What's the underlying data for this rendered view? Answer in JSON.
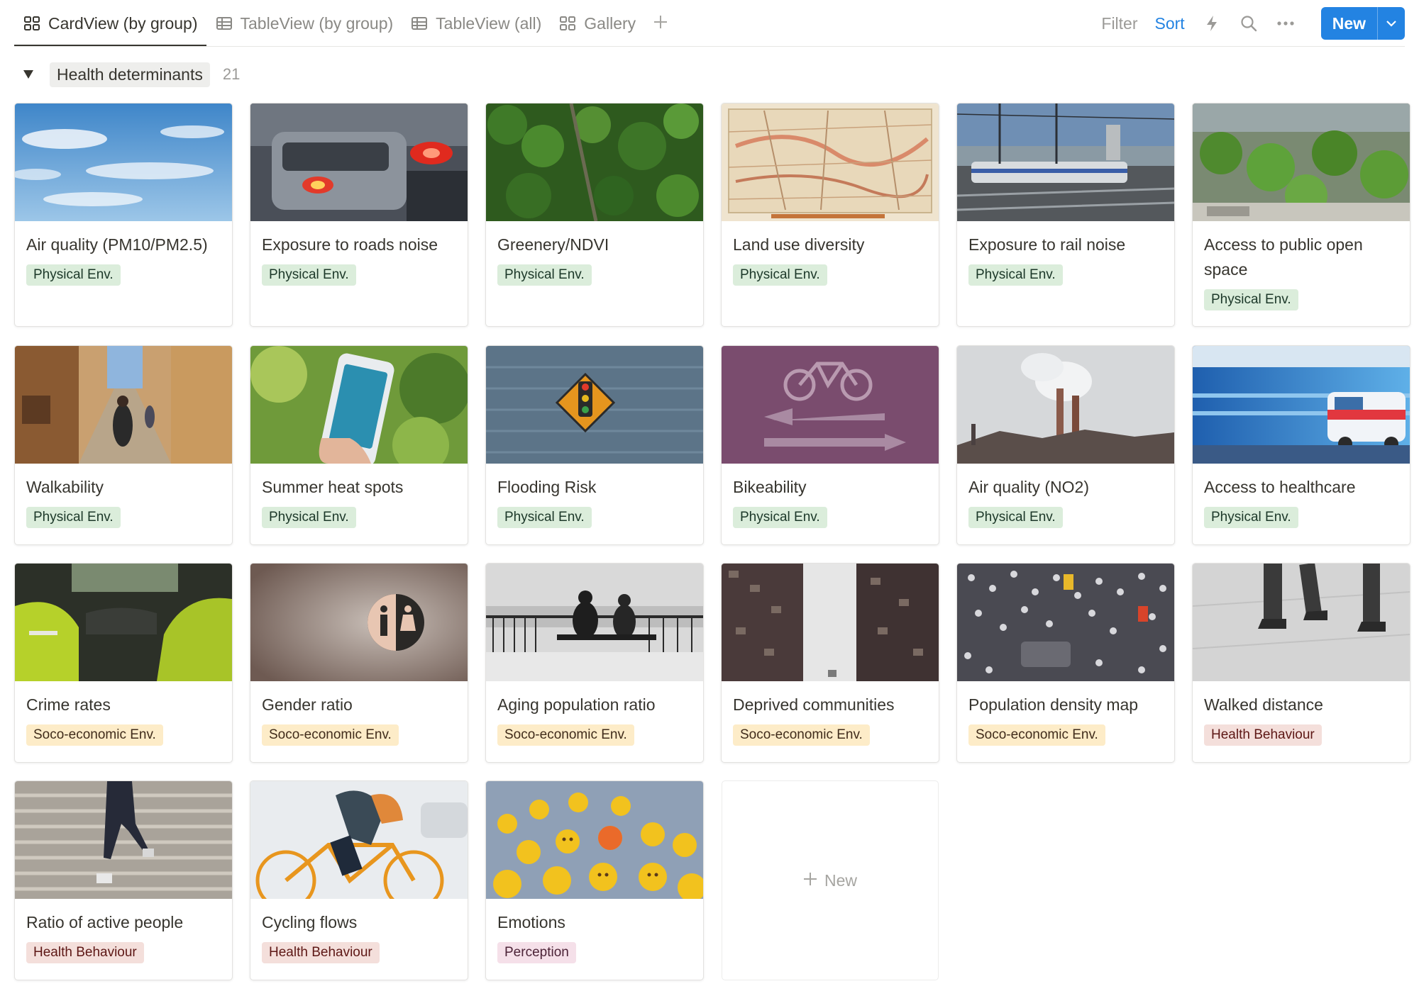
{
  "views": {
    "tabs": [
      {
        "label": "CardView (by group)",
        "icon": "card-grid-icon",
        "active": true
      },
      {
        "label": "TableView (by group)",
        "icon": "table-icon",
        "active": false
      },
      {
        "label": "TableView (all)",
        "icon": "table-icon",
        "active": false
      },
      {
        "label": "Gallery",
        "icon": "gallery-grid-icon",
        "active": false
      }
    ],
    "add_icon": "plus-icon"
  },
  "actions": {
    "filter_label": "Filter",
    "sort_label": "Sort",
    "automation_icon": "lightning-icon",
    "search_icon": "search-icon",
    "more_icon": "more-dots-icon",
    "new_label": "New",
    "new_dropdown_icon": "chevron-down-icon"
  },
  "group": {
    "label": "Health determinants",
    "count": "21",
    "toggle_icon": "triangle-down-icon"
  },
  "cards": [
    {
      "title": "Air quality (PM10/PM2.5)",
      "tag": "Physical Env.",
      "tag_type": "phys",
      "cover": "blue sky with wispy clouds"
    },
    {
      "title": "Exposure to roads noise",
      "tag": "Physical Env.",
      "tag_type": "phys",
      "cover": "car tail lights in traffic"
    },
    {
      "title": "Greenery/NDVI",
      "tag": "Physical Env.",
      "tag_type": "phys",
      "cover": "aerial view of forest"
    },
    {
      "title": "Land use diversity",
      "tag": "Physical Env.",
      "tag_type": "phys",
      "cover": "old city map"
    },
    {
      "title": "Exposure to rail noise",
      "tag": "Physical Env.",
      "tag_type": "phys",
      "cover": "train at station"
    },
    {
      "title": "Access to public open space",
      "tag": "Physical Env.",
      "tag_type": "phys",
      "cover": "rooftop garden park"
    },
    {
      "title": "Walkability",
      "tag": "Physical Env.",
      "tag_type": "phys",
      "cover": "people walking narrow street"
    },
    {
      "title": "Summer heat spots",
      "tag": "Physical Env.",
      "tag_type": "phys",
      "cover": "hand holding phone with weather app"
    },
    {
      "title": "Flooding Risk",
      "tag": "Physical Env.",
      "tag_type": "phys",
      "cover": "traffic sign in flood water"
    },
    {
      "title": "Bikeability",
      "tag": "Physical Env.",
      "tag_type": "phys",
      "cover": "bike lane marking on purple surface"
    },
    {
      "title": "Air quality (NO2)",
      "tag": "Physical Env.",
      "tag_type": "phys",
      "cover": "industrial chimneys with smoke"
    },
    {
      "title": "Access to healthcare",
      "tag": "Physical Env.",
      "tag_type": "phys",
      "cover": "ambulance in motion"
    },
    {
      "title": "Crime rates",
      "tag": "Soco-economic Env.",
      "tag_type": "soco",
      "cover": "police officers in car"
    },
    {
      "title": "Gender ratio",
      "tag": "Soco-economic Env.",
      "tag_type": "soco",
      "cover": "male female restroom sign"
    },
    {
      "title": "Aging population ratio",
      "tag": "Soco-economic Env.",
      "tag_type": "soco",
      "cover": "elderly people by seaside railing"
    },
    {
      "title": "Deprived communities",
      "tag": "Soco-economic Env.",
      "tag_type": "soco",
      "cover": "dense apartment towers"
    },
    {
      "title": "Population density map",
      "tag": "Soco-economic Env.",
      "tag_type": "soco",
      "cover": "crowded street from above"
    },
    {
      "title": "Walked distance",
      "tag": "Health Behaviour",
      "tag_type": "health",
      "cover": "legs walking on pavement"
    },
    {
      "title": "Ratio of active people",
      "tag": "Health Behaviour",
      "tag_type": "health",
      "cover": "person running up stairs"
    },
    {
      "title": "Cycling flows",
      "tag": "Health Behaviour",
      "tag_type": "health",
      "cover": "cyclist on orange bike"
    },
    {
      "title": "Emotions",
      "tag": "Perception",
      "tag_type": "perc",
      "cover": "emoji balls"
    }
  ],
  "new_card": {
    "label": "New",
    "icon": "plus-icon"
  }
}
